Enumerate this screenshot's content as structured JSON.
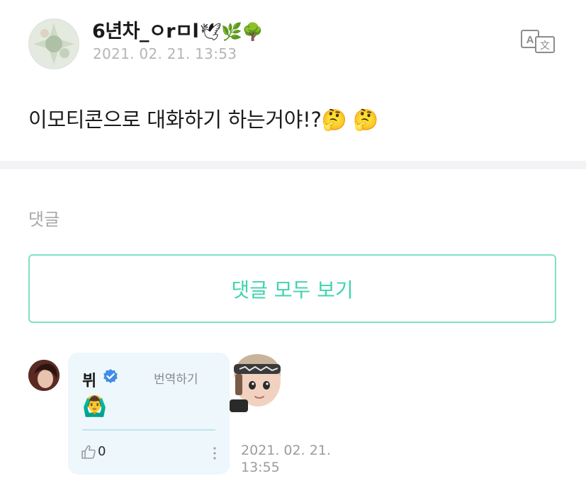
{
  "post": {
    "author_name": "6년차_ㅇrㅁl",
    "author_emoji": "🕊🌿🌳",
    "date": "2021. 02. 21. 13:53",
    "body": "이모티콘으로 대화하기 하는거야!?🤔 🤔",
    "translate_icon": "translate-icon"
  },
  "comments_section": {
    "label": "댓글",
    "view_all_label": "댓글 모두 보기"
  },
  "comment": {
    "author": "뷔",
    "verified_icon": "verified-badge-icon",
    "translate_label": "번역하기",
    "emoji": "🙆‍♂️",
    "like_count": "0",
    "date_line1": "2021. 02. 21.",
    "date_line2": "13:55",
    "sticker": "character-sticker"
  },
  "colors": {
    "accent": "#3fd3ae",
    "accent_border": "#7ee0c8",
    "bubble_bg": "#eef7fb",
    "verified": "#3f8de6",
    "muted_text": "#b5b5b5"
  }
}
